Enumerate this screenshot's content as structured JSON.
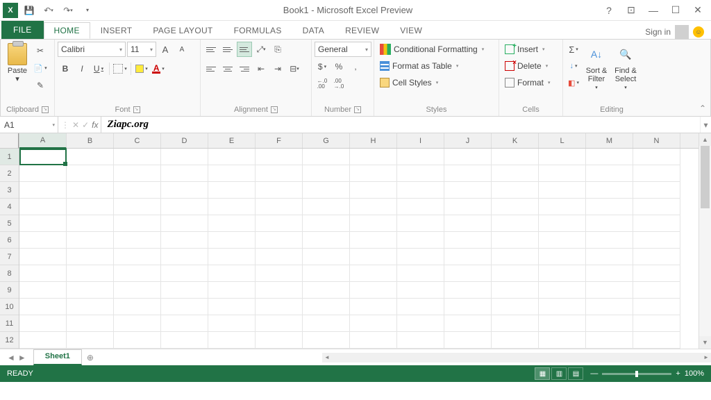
{
  "titlebar": {
    "title": "Book1 - Microsoft Excel Preview"
  },
  "tabs": {
    "file": "FILE",
    "home": "HOME",
    "insert": "INSERT",
    "page_layout": "PAGE LAYOUT",
    "formulas": "FORMULAS",
    "data": "DATA",
    "review": "REVIEW",
    "view": "VIEW",
    "signin": "Sign in"
  },
  "ribbon": {
    "clipboard": {
      "label": "Clipboard",
      "paste": "Paste"
    },
    "font": {
      "label": "Font",
      "name": "Calibri",
      "size": "11",
      "inc": "A",
      "dec": "A",
      "bold": "B",
      "italic": "I",
      "underline": "U"
    },
    "alignment": {
      "label": "Alignment"
    },
    "number": {
      "label": "Number",
      "format": "General",
      "currency": "$",
      "percent": "%",
      "comma": ",",
      "inc_dec": "←.0\n.00",
      "dec_dec": ".00\n→.0"
    },
    "styles": {
      "label": "Styles",
      "conditional": "Conditional Formatting",
      "table": "Format as Table",
      "cell": "Cell Styles"
    },
    "cells": {
      "label": "Cells",
      "insert": "Insert",
      "delete": "Delete",
      "format": "Format"
    },
    "editing": {
      "label": "Editing",
      "sort": "Sort &\nFilter",
      "find": "Find &\nSelect"
    }
  },
  "namebox": {
    "value": "A1"
  },
  "formula_bar": {
    "fx": "fx",
    "value": "Ziapc.org"
  },
  "columns": [
    "A",
    "B",
    "C",
    "D",
    "E",
    "F",
    "G",
    "H",
    "I",
    "J",
    "K",
    "L",
    "M",
    "N"
  ],
  "rows": [
    "1",
    "2",
    "3",
    "4",
    "5",
    "6",
    "7",
    "8",
    "9",
    "10",
    "11",
    "12"
  ],
  "sheet": {
    "name": "Sheet1"
  },
  "status": {
    "ready": "READY",
    "zoom": "100%"
  }
}
